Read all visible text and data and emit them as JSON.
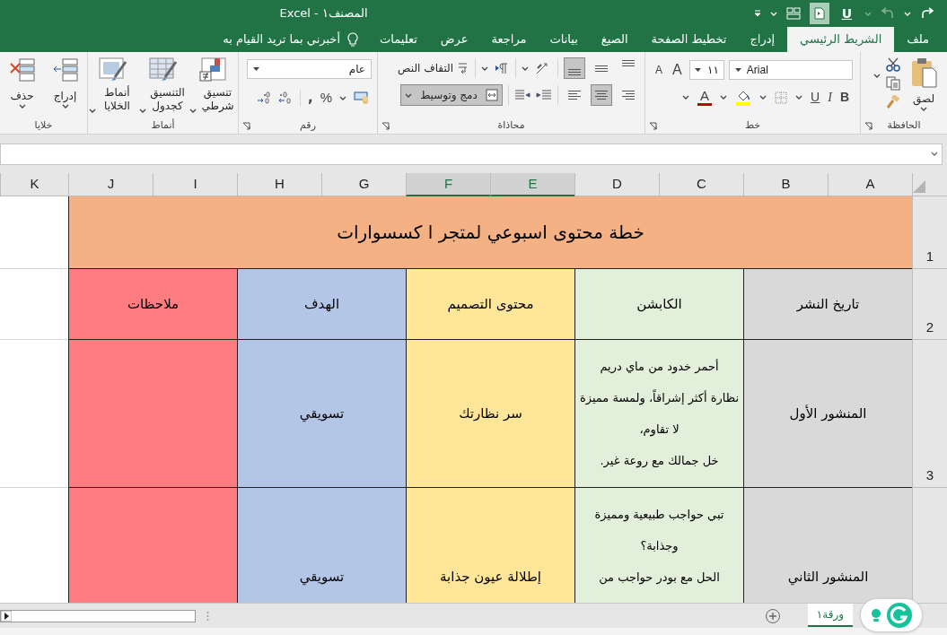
{
  "window": {
    "title": "المصنف١ - Excel"
  },
  "quick_access": {
    "underline": "U"
  },
  "ribbon_tabs": [
    {
      "label": "ملف",
      "selected": false
    },
    {
      "label": "الشريط الرئيسي",
      "selected": true
    },
    {
      "label": "إدراج",
      "selected": false
    },
    {
      "label": "تخطيط الصفحة",
      "selected": false
    },
    {
      "label": "الصيغ",
      "selected": false
    },
    {
      "label": "بيانات",
      "selected": false
    },
    {
      "label": "مراجعة",
      "selected": false
    },
    {
      "label": "عرض",
      "selected": false
    },
    {
      "label": "تعليمات",
      "selected": false
    }
  ],
  "tell_me": "أخبرني بما تريد القيام به",
  "clipboard": {
    "title": "الحافظة",
    "paste": "لصق"
  },
  "font": {
    "title": "خط",
    "name": "Arial",
    "size": "١١",
    "grow": "A",
    "shrink": "A",
    "bold": "B",
    "italic": "I",
    "underline": "U",
    "color_letter": "A"
  },
  "alignment": {
    "title": "محاذاة",
    "wrap_text": "التفاف النص",
    "merge": {
      "label": "دمج وتوسيط",
      "selected": true
    },
    "vertical": [
      {
        "kind": "top",
        "selected": false
      },
      {
        "kind": "middle",
        "selected": false
      },
      {
        "kind": "bottom",
        "selected": true
      }
    ],
    "horizontal": [
      {
        "kind": "right",
        "selected": false
      },
      {
        "kind": "center",
        "selected": true
      },
      {
        "kind": "left",
        "selected": false
      }
    ]
  },
  "number": {
    "title": "رقم",
    "format": "عام",
    "percent": "%",
    "comma": ","
  },
  "styles": {
    "title": "أنماط",
    "buttons": [
      {
        "kind": "conditional",
        "label": "تنسيق شرطي"
      },
      {
        "kind": "table",
        "label": "التنسيق كجدول"
      },
      {
        "kind": "cell",
        "label": "أنماط الخلايا"
      }
    ]
  },
  "cells": {
    "title": "خلايا",
    "buttons": [
      {
        "kind": "insert",
        "label": "إدراج"
      },
      {
        "kind": "delete",
        "label": "حذف"
      }
    ]
  },
  "sheet": {
    "columns": [
      {
        "label": "A",
        "selected": false
      },
      {
        "label": "B",
        "selected": false
      },
      {
        "label": "C",
        "selected": false
      },
      {
        "label": "D",
        "selected": false
      },
      {
        "label": "E",
        "selected": true
      },
      {
        "label": "F",
        "selected": true
      },
      {
        "label": "G",
        "selected": false
      },
      {
        "label": "H",
        "selected": false
      },
      {
        "label": "I",
        "selected": false
      },
      {
        "label": "J",
        "selected": false
      },
      {
        "label": "K",
        "selected": false
      }
    ],
    "row_numbers": [
      "1",
      "2",
      "3"
    ],
    "title": {
      "text": "خطة محتوى اسبوعي لمتجر ا كسسوارات",
      "color": "#f4b183"
    },
    "header": [
      {
        "text": "تاريخ النشر",
        "color": "#d9d9d9"
      },
      {
        "text": "الكابشن",
        "color": "#e2efda"
      },
      {
        "text": "محتوى التصميم",
        "color": "#ffe699"
      },
      {
        "text": "الهدف",
        "color": "#b4c6e7"
      },
      {
        "text": "ملاحظات",
        "color": "#ff7c80"
      }
    ],
    "rows": [
      {
        "date": "المنشور الأول",
        "caption": [
          "أحمر خدود من ماي دريم",
          "نظارة أكثر إشراقاً، ولمسة مميزة",
          "لا تقاوم،",
          "خل جمالك مع روعة غير."
        ],
        "design": "سر نظارتك",
        "goal": "تسويقي"
      },
      {
        "date": "المنشور الثاني",
        "caption": [
          "تبي حواجب طبيعية ومميزة",
          "وجذابة؟",
          "الحل مع بودر حواجب من"
        ],
        "design": "إطلالة عيون جذابة",
        "goal": "تسويقي"
      }
    ]
  },
  "sheet_tabs": [
    {
      "label": "ورقة١",
      "selected": true
    }
  ]
}
